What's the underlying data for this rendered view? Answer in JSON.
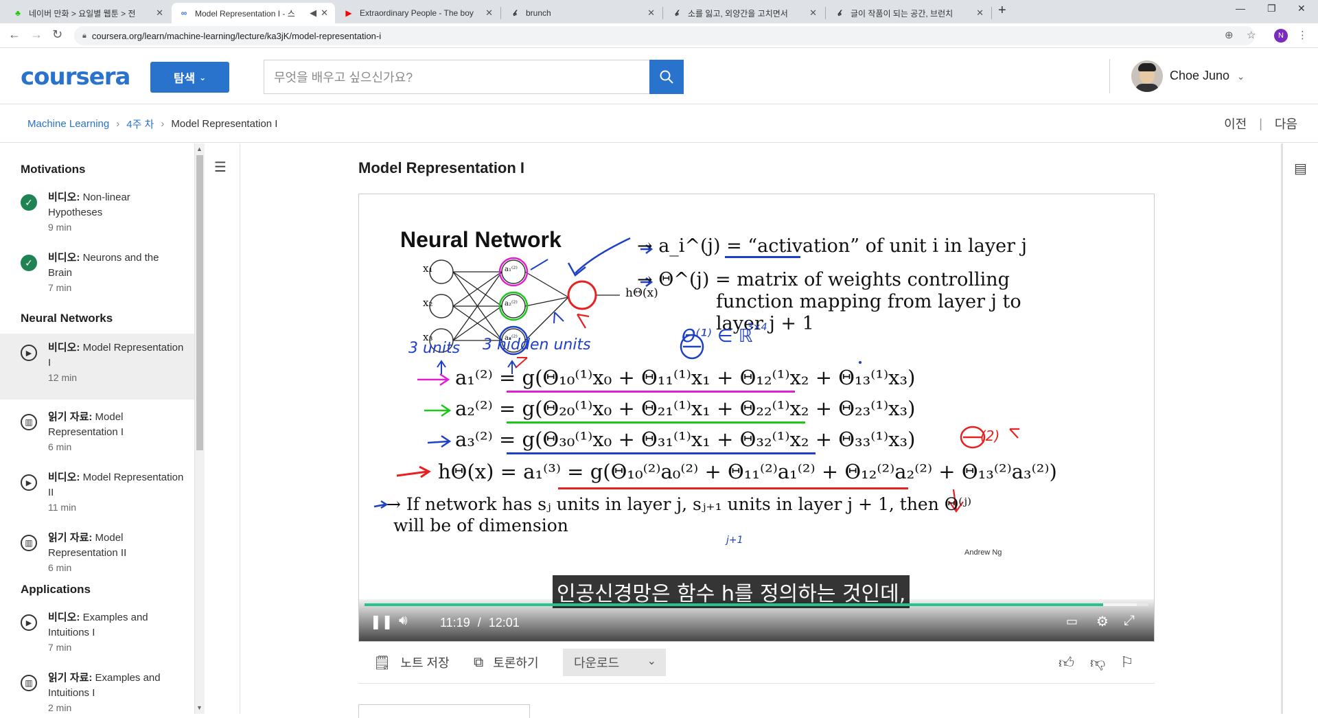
{
  "browser": {
    "tabs": [
      {
        "title": "네이버 만화 > 요일별 웹툰 > 전",
        "icon": "naver-webtoon-icon"
      },
      {
        "title": "Model Representation I - 스",
        "icon": "coursera-icon",
        "extra": "◀"
      },
      {
        "title": "Extraordinary People - The boy",
        "icon": "youtube-icon"
      },
      {
        "title": "brunch",
        "icon": "brunch-icon"
      },
      {
        "title": "소를 잃고, 외양간을 고치면서",
        "icon": "brunch-icon"
      },
      {
        "title": "글이 작품이 되는 공간, 브런치",
        "icon": "brunch-icon"
      }
    ],
    "url": "coursera.org/learn/machine-learning/lecture/ka3jK/model-representation-i",
    "profile_initial": "N"
  },
  "header": {
    "logo": "coursera",
    "explore_label": "탐색",
    "search_placeholder": "무엇을 배우고 싶으신가요?",
    "user_name": "Choe Juno"
  },
  "breadcrumb": {
    "course": "Machine Learning",
    "week": "4주 차",
    "current": "Model Representation I",
    "prev": "이전",
    "next": "다음"
  },
  "sidebar": {
    "sections": [
      {
        "title": "Motivations"
      },
      {
        "title": "Neural Networks"
      },
      {
        "title": "Applications"
      }
    ],
    "items": [
      {
        "type_label": "비디오:",
        "title": "Non-linear Hypotheses",
        "duration": "9 min"
      },
      {
        "type_label": "비디오:",
        "title": "Neurons and the Brain",
        "duration": "7 min"
      },
      {
        "type_label": "비디오:",
        "title": "Model Representation I",
        "duration": "12 min"
      },
      {
        "type_label": "읽기 자료:",
        "title": "Model Representation I",
        "duration": "6 min"
      },
      {
        "type_label": "비디오:",
        "title": "Model Representation II",
        "duration": "11 min"
      },
      {
        "type_label": "읽기 자료:",
        "title": "Model Representation II",
        "duration": "6 min"
      },
      {
        "type_label": "비디오:",
        "title": "Examples and Intuitions I",
        "duration": "7 min"
      },
      {
        "type_label": "읽기 자료:",
        "title": "Examples and Intuitions I",
        "duration": "2 min"
      }
    ]
  },
  "main": {
    "title": "Model Representation I"
  },
  "slide": {
    "title": "Neural Network",
    "def1": "→ a_i^(j) = “activation” of unit i in layer j",
    "def2a": "→ Θ^(j) = matrix of weights controlling",
    "def2b": "function mapping from layer j to",
    "def2c": "layer j + 1",
    "eq1": "a₁⁽²⁾ = g(Θ₁₀⁽¹⁾x₀ + Θ₁₁⁽¹⁾x₁ + Θ₁₂⁽¹⁾x₂ + Θ₁₃⁽¹⁾x₃)",
    "eq2": "a₂⁽²⁾ = g(Θ₂₀⁽¹⁾x₀ + Θ₂₁⁽¹⁾x₁ + Θ₂₂⁽¹⁾x₂ + Θ₂₃⁽¹⁾x₃)",
    "eq3": "a₃⁽²⁾ = g(Θ₃₀⁽¹⁾x₀ + Θ₃₁⁽¹⁾x₁ + Θ₃₂⁽¹⁾x₂ + Θ₃₃⁽¹⁾x₃)",
    "eq4": "hΘ(x) = a₁⁽³⁾ = g(Θ₁₀⁽²⁾a₀⁽²⁾ + Θ₁₁⁽²⁾a₁⁽²⁾ + Θ₁₂⁽²⁾a₂⁽²⁾ + Θ₁₃⁽²⁾a₃⁽²⁾)",
    "line5a": "→ If network has sⱼ units in layer j, sⱼ₊₁ units in layer j + 1, then Θ⁽ʲ⁾",
    "line5b": "will be of dimension",
    "nodes_in": [
      "x₁",
      "x₂",
      "x₃"
    ],
    "nodes_hidden": [
      "a₁⁽²⁾",
      "a₂⁽²⁾",
      "a₃⁽²⁾"
    ],
    "output": "hΘ(x)",
    "note_units": "3 units",
    "note_hidden": "3 hidden units",
    "note_theta": "Θ⁽¹⁾ ∈ ℝ",
    "note_dim": "3×4",
    "note_theta2": "Θ",
    "note_theta2_sup": "(2)",
    "note_j": "j+1",
    "author": "Andrew Ng",
    "subtitle": "인공신경망은 함수 h를 정의하는 것인데,",
    "time_current": "11:19",
    "time_sep": "/",
    "time_total": "12:01",
    "progress_fraction": 0.942,
    "buffered_fraction": 0.985
  },
  "actions": {
    "save_note": "노트 저장",
    "discuss": "토론하기",
    "download": "다운로드"
  },
  "colors": {
    "brand": "#2a73cc",
    "complete": "#1f8354",
    "progress": "#28c28a"
  }
}
